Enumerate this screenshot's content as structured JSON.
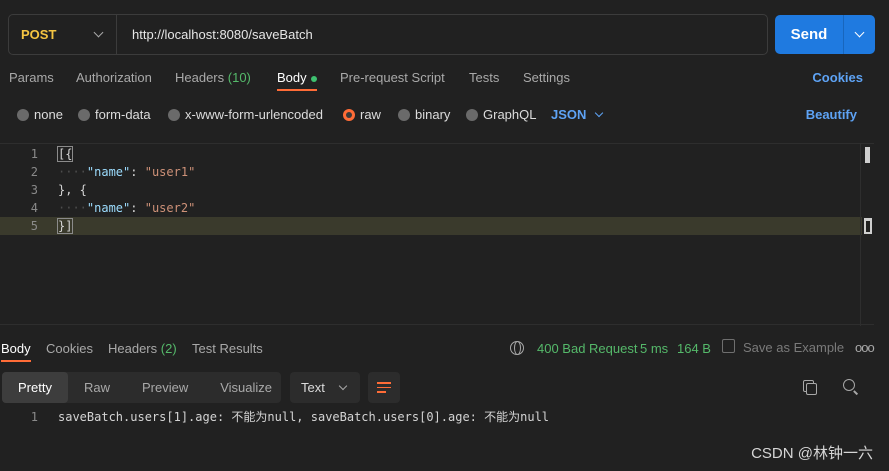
{
  "request": {
    "method": "POST",
    "url": "http://localhost:8080/saveBatch",
    "send_label": "Send"
  },
  "request_tabs": {
    "params": "Params",
    "authorization": "Authorization",
    "headers": "Headers",
    "headers_count": "(10)",
    "body": "Body",
    "pre_request": "Pre-request Script",
    "tests": "Tests",
    "settings": "Settings",
    "cookies": "Cookies"
  },
  "body_types": {
    "none": "none",
    "form_data": "form-data",
    "urlencoded": "x-www-form-urlencoded",
    "raw": "raw",
    "binary": "binary",
    "graphql": "GraphQL",
    "selected": "raw",
    "language": "JSON",
    "beautify": "Beautify"
  },
  "editor": {
    "line_numbers": [
      "1",
      "2",
      "3",
      "4",
      "5"
    ],
    "lines": {
      "l1": "[{",
      "l2_key": "\"name\"",
      "l2_sep": ": ",
      "l2_val": "\"user1\"",
      "l3": "}, {",
      "l4_key": "\"name\"",
      "l4_sep": ": ",
      "l4_val": "\"user2\"",
      "l5": "}]"
    }
  },
  "response_tabs": {
    "body": "Body",
    "cookies": "Cookies",
    "headers": "Headers",
    "headers_count": "(2)",
    "test_results": "Test Results"
  },
  "response_meta": {
    "status": "400 Bad Request",
    "time": "5 ms",
    "size": "164 B",
    "save_example": "Save as Example",
    "more": "ooo"
  },
  "response_toolbar": {
    "pretty": "Pretty",
    "raw": "Raw",
    "preview": "Preview",
    "visualize": "Visualize",
    "format": "Text"
  },
  "response_body": {
    "line_number": "1",
    "text": "saveBatch.users[1].age: 不能为null, saveBatch.users[0].age: 不能为null"
  },
  "watermark": "CSDN @林钟一六",
  "colors": {
    "accent": "#ff6c37",
    "send": "#1f7ae0",
    "link": "#5ea3f5",
    "status": "#55b96a",
    "method": "#f5c542"
  }
}
